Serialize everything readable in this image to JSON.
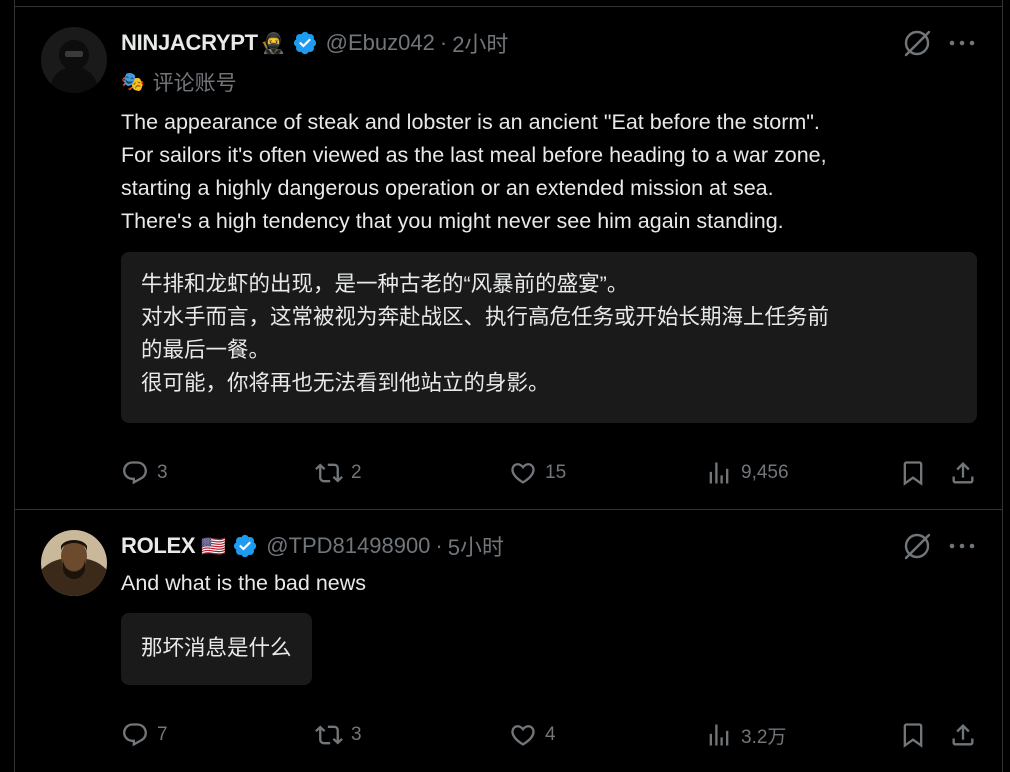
{
  "tweets": [
    {
      "name": "NINJACRYPT",
      "name_emoji": "🥷",
      "handle": "@Ebuz042",
      "separator": "·",
      "time": "2小时",
      "badge_emoji": "🎭",
      "badge_label": "评论账号",
      "text_lines": [
        "The appearance of steak and lobster is an ancient \"Eat before the storm\".",
        "For sailors it's often viewed as the last meal before heading to a war zone,",
        "starting a highly dangerous operation or an extended mission at sea.",
        "There's a high tendency that you might never see him again standing."
      ],
      "translation_lines": [
        "牛排和龙虾的出现，是一种古老的“风暴前的盛宴”。",
        "对水手而言，这常被视为奔赴战区、执行高危任务或开始长期海上任务前",
        "的最后一餐。",
        "很可能，你将再也无法看到他站立的身影。"
      ],
      "replies": "3",
      "retweets": "2",
      "likes": "15",
      "views": "9,456"
    },
    {
      "name": "ROLEX",
      "name_emoji": "🇺🇸",
      "handle": "@TPD81498900",
      "separator": "·",
      "time": "5小时",
      "text_lines": [
        "And what is the bad news"
      ],
      "translation_lines": [
        "那坏消息是什么"
      ],
      "replies": "7",
      "retweets": "3",
      "likes": "4",
      "views": "3.2万"
    }
  ],
  "colors": {
    "background": "#000000",
    "text": "#e7e9ea",
    "muted": "#71767b",
    "verified": "#1d9bf0",
    "translation_bg": "#1b1a1a",
    "border": "#2f3336"
  },
  "icons": [
    "verified-badge-icon",
    "grok-icon",
    "more-icon",
    "reply-icon",
    "retweet-icon",
    "like-icon",
    "views-icon",
    "bookmark-icon",
    "share-icon",
    "mask-icon"
  ]
}
